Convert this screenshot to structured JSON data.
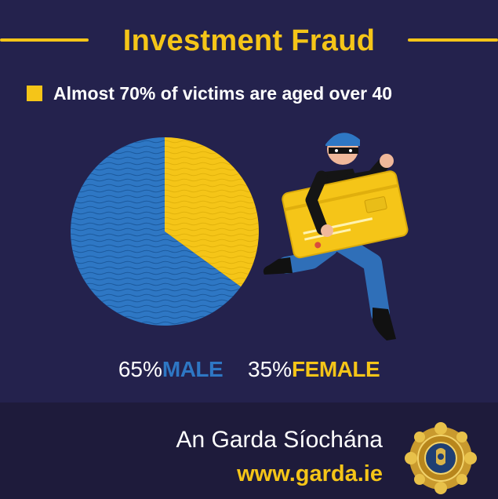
{
  "title": "Investment Fraud",
  "headline": "Almost 70% of victims are aged over 40",
  "chart_data": {
    "type": "pie",
    "slices": [
      {
        "label": "MALE",
        "value": 65,
        "pct_text": "65%",
        "color": "#2e77c4"
      },
      {
        "label": "FEMALE",
        "value": 35,
        "pct_text": "35%",
        "color": "#f5c518"
      }
    ]
  },
  "footer": {
    "org_name": "An Garda Síochána",
    "url": "www.garda.ie"
  },
  "colors": {
    "background": "#24224d",
    "footer_background": "#1e1b3b",
    "accent_yellow": "#f5c518",
    "accent_blue": "#2e77c4"
  },
  "icons": [
    "thief-with-credit-card-illustration",
    "garda-crest-icon"
  ]
}
